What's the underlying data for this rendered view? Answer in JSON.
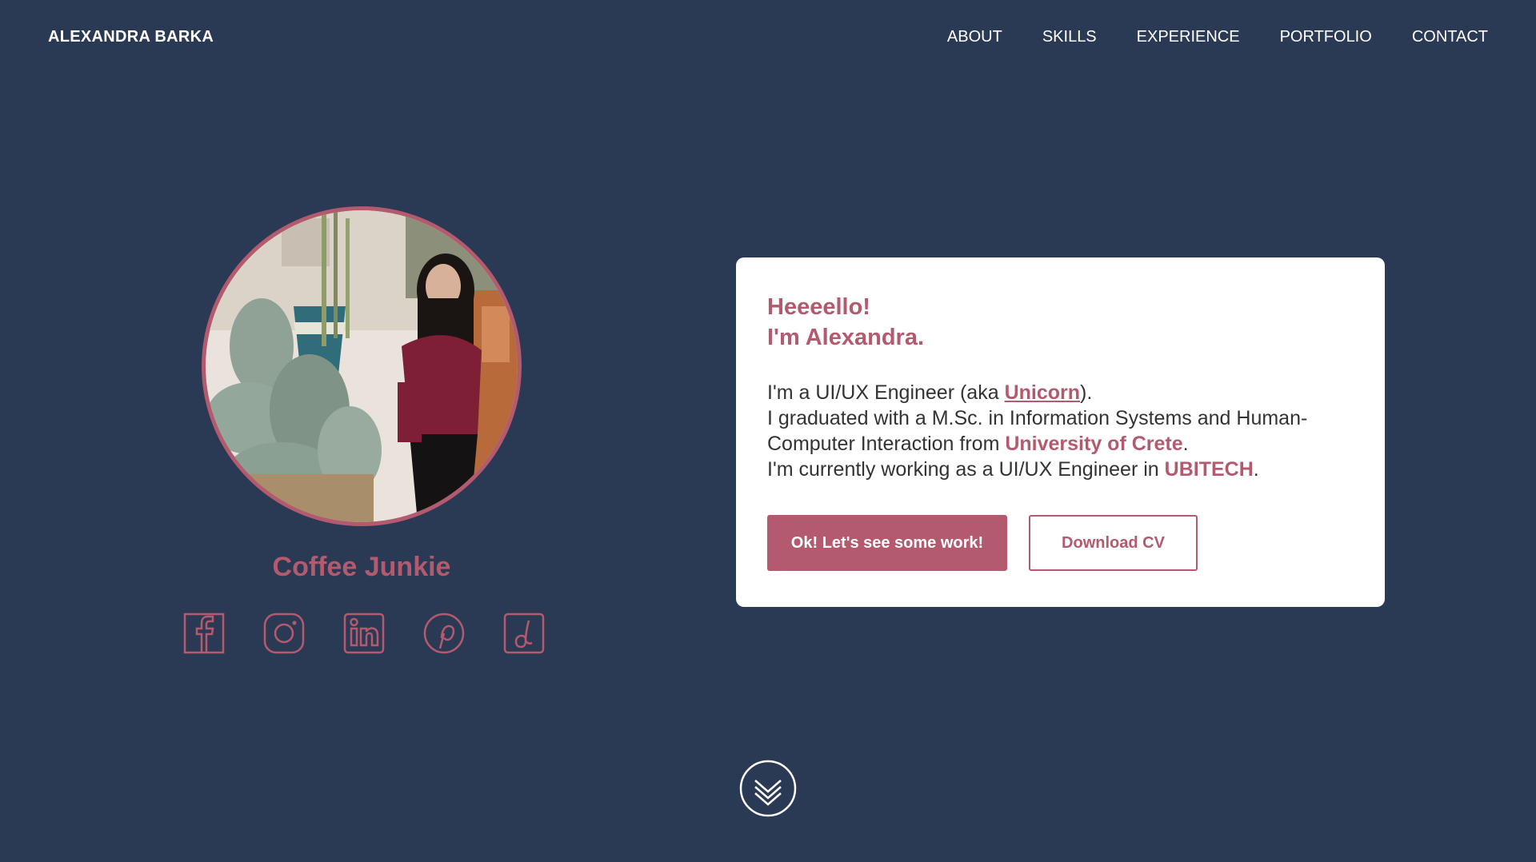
{
  "nav": {
    "brand": "ALEXANDRA BARKA",
    "items": [
      {
        "label": "ABOUT"
      },
      {
        "label": "SKILLS"
      },
      {
        "label": "EXPERIENCE"
      },
      {
        "label": "PORTFOLIO"
      },
      {
        "label": "CONTACT"
      }
    ]
  },
  "profile": {
    "tagline": "Coffee Junkie",
    "socials": [
      {
        "icon": "facebook-icon"
      },
      {
        "icon": "instagram-icon"
      },
      {
        "icon": "linkedin-icon"
      },
      {
        "icon": "pinterest-icon"
      },
      {
        "icon": "dribbble-icon"
      }
    ]
  },
  "intro": {
    "greeting_line1": "Heeeello!",
    "greeting_line2": "I'm Alexandra.",
    "line1_prefix": "I'm a UI/UX Engineer (aka ",
    "line1_link": "Unicorn",
    "line1_suffix": ").",
    "line2": "I graduated with a M.Sc. in Information Systems and Human-",
    "line3_prefix": "Computer Interaction from ",
    "line3_highlight": "University of Crete",
    "line3_suffix": ".",
    "line4_prefix": "I'm currently working as a UI/UX Engineer in ",
    "line4_highlight": "UBITECH",
    "line4_suffix": ".",
    "primary_button": "Ok! Let's see some work!",
    "secondary_button": "Download CV"
  },
  "colors": {
    "background": "#2b3a54",
    "accent": "#b35a6e",
    "card": "#ffffff"
  }
}
